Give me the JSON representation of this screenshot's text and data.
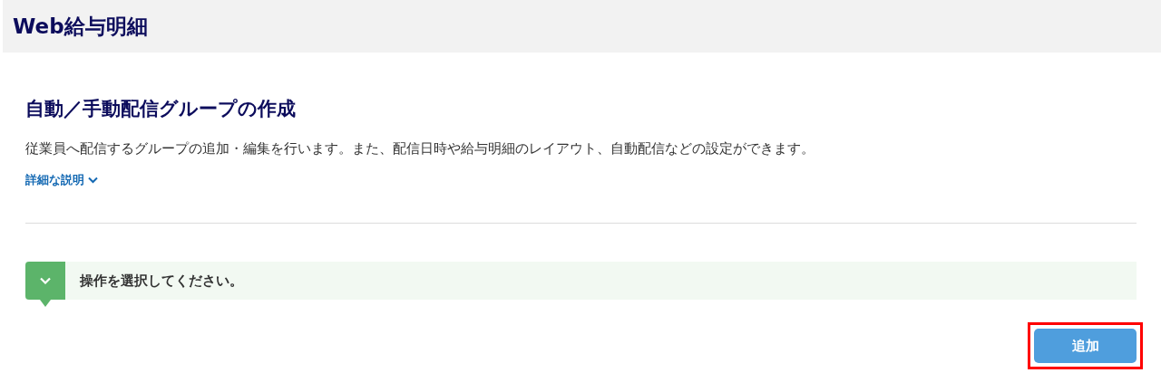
{
  "app_title": "Web給与明細",
  "page": {
    "title": "自動／手動配信グループの作成",
    "description": "従業員へ配信するグループの追加・編集を行います。また、配信日時や給与明細のレイアウト、自動配信などの設定ができます。",
    "details_link": {
      "label": "詳細な説明",
      "expanded": false
    }
  },
  "step": {
    "message": "操作を選択してください。",
    "expanded": true
  },
  "add_button": {
    "label": "追加",
    "highlighted": true
  }
}
